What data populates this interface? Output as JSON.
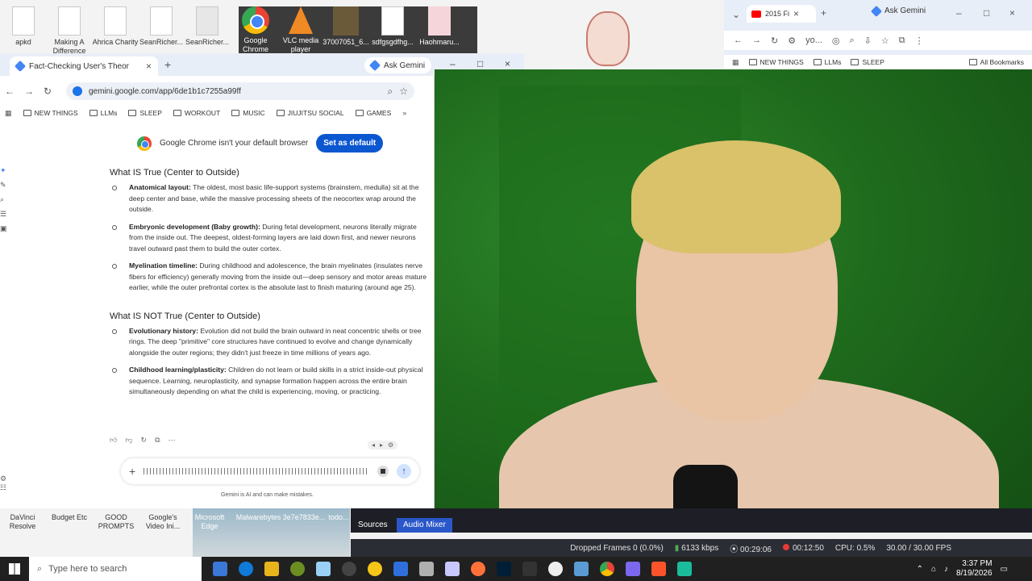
{
  "desktop": {
    "top_icons": [
      {
        "label": "apkd"
      },
      {
        "label": "Making A\nDifference"
      },
      {
        "label": "Ahrica Charity"
      },
      {
        "label": "SeanRicher..."
      },
      {
        "label": "SeanRicher..."
      },
      {
        "label": "Google\nChrome"
      },
      {
        "label": "VLC media\nplayer"
      },
      {
        "label": "37007051_6..."
      },
      {
        "label": "sdfgsgdfhg..."
      },
      {
        "label": "Haohmaru..."
      }
    ],
    "bottom_icons": [
      {
        "label": "DaVinci\nResolve"
      },
      {
        "label": "Budget Etc"
      },
      {
        "label": "GOOD\nPROMPTS"
      },
      {
        "label": "Google's\nVideo Ini..."
      },
      {
        "label": "Microsoft\nEdge"
      },
      {
        "label": "Malwarebytes 3e7e7833e..."
      },
      {
        "label": "todo..."
      }
    ]
  },
  "main_window": {
    "tab_title": "Fact-Checking User's Theor",
    "ask_gemini": "Ask Gemini",
    "url": "gemini.google.com/app/6de1b1c7255a99ff",
    "bookmarks": [
      "NEW THINGS",
      "LLMs",
      "SLEEP",
      "WORKOUT",
      "MUSIC",
      "JIUJITSU SOCIAL",
      "GAMES"
    ],
    "notice": {
      "text": "Google Chrome isn't your default browser",
      "button": "Set as default"
    },
    "section_true": {
      "heading": "What IS True (Center to Outside)",
      "items": [
        {
          "bold": "Anatomical layout:",
          "text": " The oldest, most basic life-support systems (brainstem, medulla) sit at the deep center and base, while the massive processing sheets of the neocortex wrap around the outside."
        },
        {
          "bold": "Embryonic development (Baby growth):",
          "text": " During fetal development, neurons literally migrate from the inside out. The deepest, oldest-forming layers are laid down first, and newer neurons travel outward past them to build the outer cortex."
        },
        {
          "bold": "Myelination timeline:",
          "text": " During childhood and adolescence, the brain myelinates (insulates nerve fibers for efficiency) generally moving from the inside out—deep sensory and motor areas mature earlier, while the outer prefrontal cortex is the absolute last to finish maturing (around age 25)."
        }
      ]
    },
    "section_not_true": {
      "heading": "What IS NOT True (Center to Outside)",
      "items": [
        {
          "bold": "Evolutionary history:",
          "text": " Evolution did not build the brain outward in neat concentric shells or tree rings. The deep \"primitive\" core structures have continued to evolve and change dynamically alongside the outer regions; they didn't just freeze in time millions of years ago."
        },
        {
          "bold": "Childhood learning/plasticity:",
          "text": " Children do not learn or build skills in a strict inside-out physical sequence. Learning, neuroplasticity, and synapse formation happen across the entire brain simultaneously depending on what the child is experiencing, moving, or practicing."
        }
      ]
    },
    "disclaimer": "Gemini is AI and can make mistakes."
  },
  "right_window": {
    "tab_title": "2015 Fi",
    "ask_gemini": "Ask Gemini",
    "omnibox_text": "yo...",
    "bookmarks": [
      "NEW THINGS",
      "LLMs",
      "SLEEP"
    ],
    "all_bookmarks": "All Bookmarks"
  },
  "obs": {
    "tabs": [
      "Sources",
      "Audio Mixer"
    ],
    "dropped_frames": "Dropped Frames 0 (0.0%)",
    "bitrate": "6133 kbps",
    "stream_time": "00:29:06",
    "rec_time": "00:12:50",
    "cpu": "CPU: 0.5%",
    "fps": "30.00 / 30.00 FPS"
  },
  "taskbar": {
    "search_placeholder": "Type here to search",
    "time": "3:37 PM",
    "date": "8/19/2026"
  },
  "colors": {
    "accent": "#0b57d0",
    "obs_active": "#2a57c9",
    "rec": "#e53935"
  }
}
